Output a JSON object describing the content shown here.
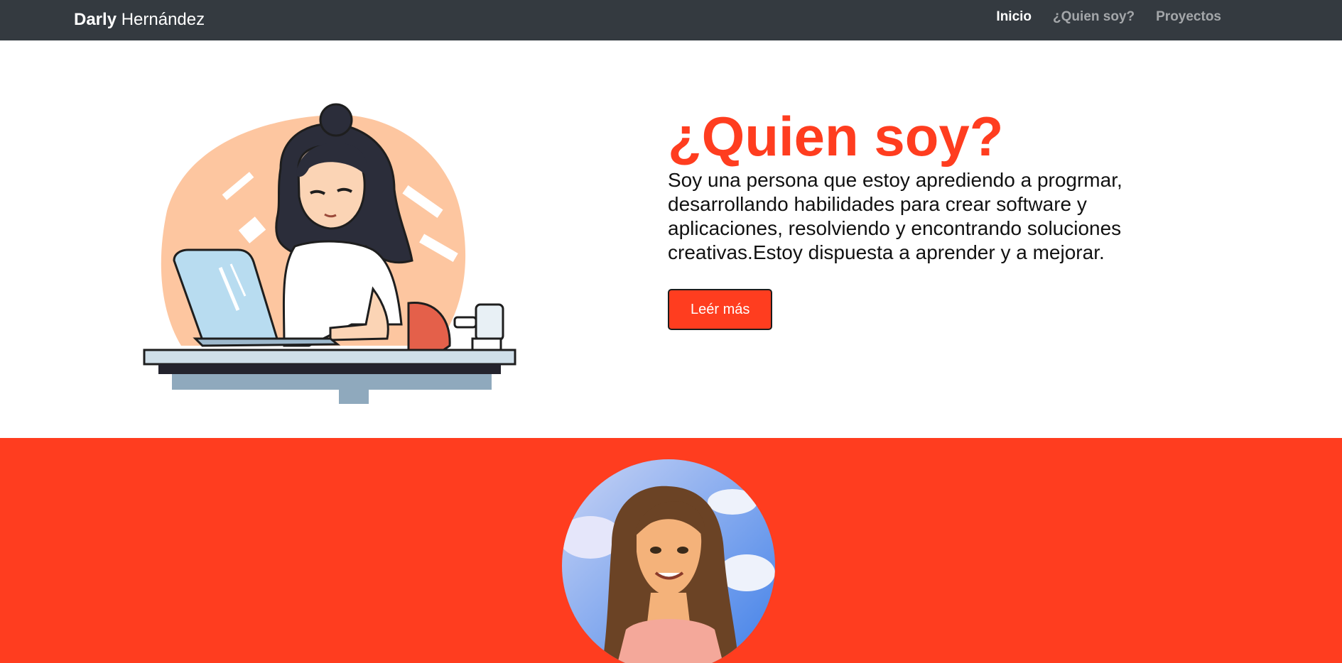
{
  "navbar": {
    "brand_first": "Darly",
    "brand_last": "Hernández",
    "links": [
      {
        "label": "Inicio",
        "active": true
      },
      {
        "label": "¿Quien soy?",
        "active": false
      },
      {
        "label": "Proyectos",
        "active": false
      }
    ]
  },
  "hero": {
    "title": "¿Quien soy?",
    "description": "Soy una persona que estoy aprediendo a progrmar, desarrollando habilidades para crear software y aplicaciones, resolviendo y encontrando soluciones creativas.Estoy dispuesta a aprender y a mejorar.",
    "button_label": "Leér más",
    "illustration_icon": "woman-at-laptop-illustration"
  },
  "about": {
    "avatar_icon": "profile-portrait-avatar"
  },
  "colors": {
    "accent": "#ff3d1f",
    "navbar_bg": "#343a40",
    "text": "#111111"
  }
}
